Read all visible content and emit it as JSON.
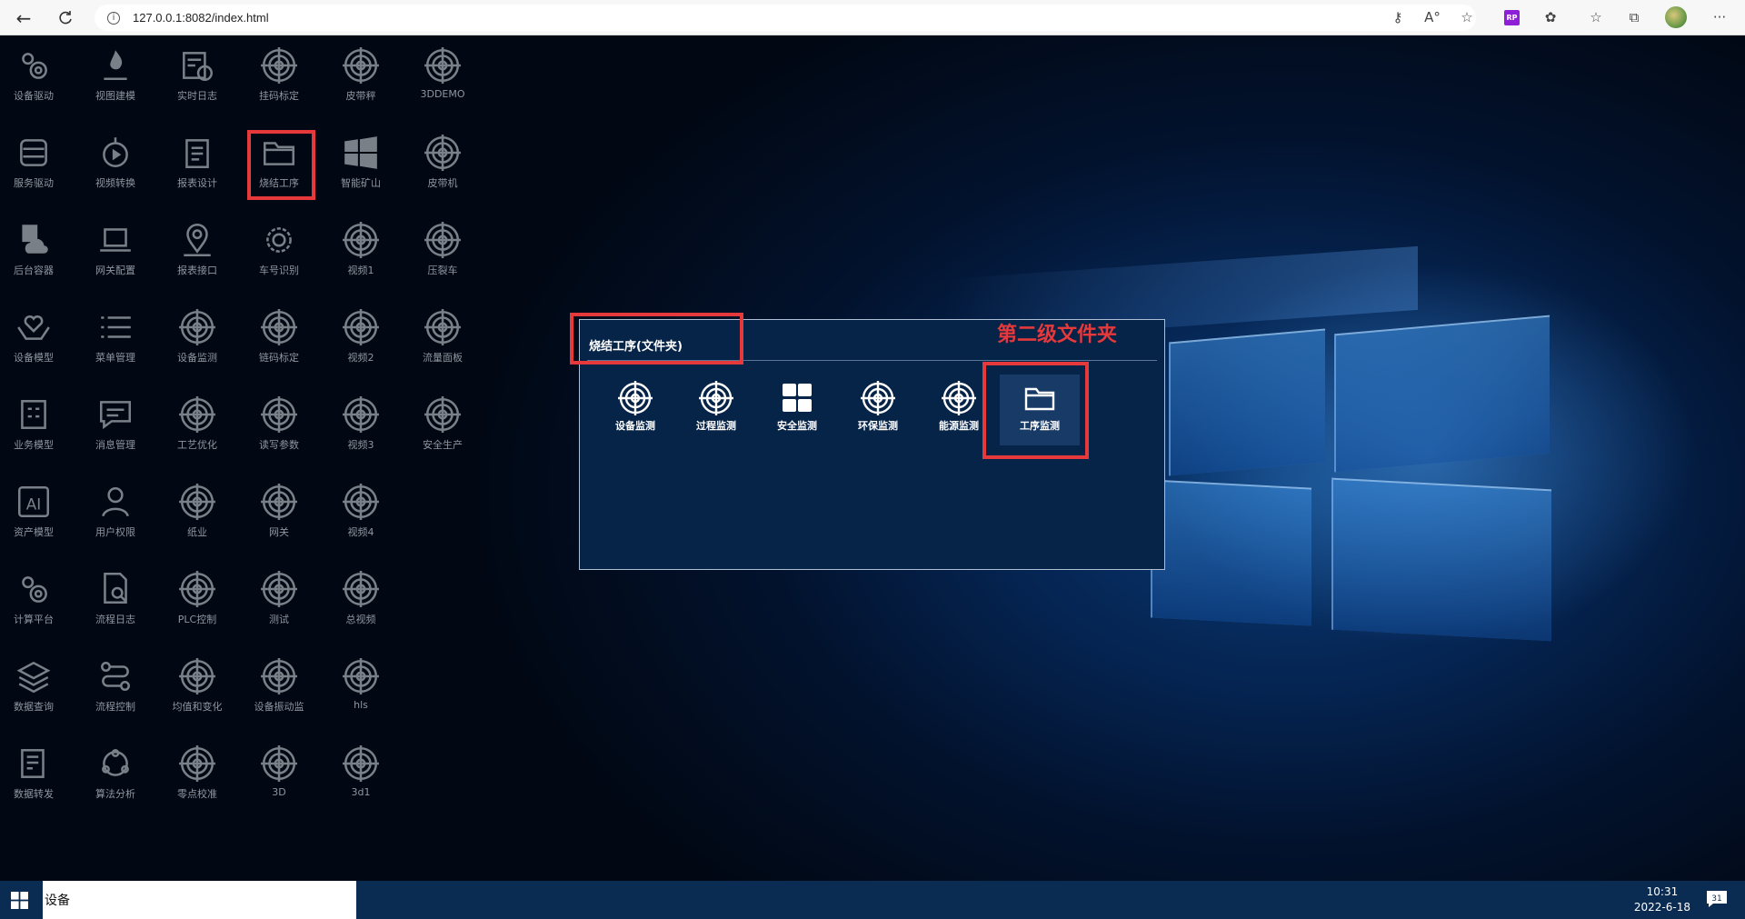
{
  "browser": {
    "url": "127.0.0.1:8082/index.html",
    "rp_badge": "RP"
  },
  "desktop_icons": [
    {
      "label": "设备驱动",
      "icon": "gears-icon"
    },
    {
      "label": "视图建模",
      "icon": "flame-icon"
    },
    {
      "label": "实时日志",
      "icon": "calendar-clock-icon"
    },
    {
      "label": "挂码标定",
      "icon": "target-icon"
    },
    {
      "label": "皮带秤",
      "icon": "target-icon"
    },
    {
      "label": "3DDEMO",
      "icon": "target-icon"
    },
    {
      "label": "服务驱动",
      "icon": "server-icon"
    },
    {
      "label": "视频转换",
      "icon": "play-circle-icon"
    },
    {
      "label": "报表设计",
      "icon": "clipboard-icon"
    },
    {
      "label": "烧结工序",
      "icon": "folder-icon"
    },
    {
      "label": "智能矿山",
      "icon": "windows-icon"
    },
    {
      "label": "皮带机",
      "icon": "target-icon"
    },
    {
      "label": "后台容器",
      "icon": "doc-cloud-icon"
    },
    {
      "label": "网关配置",
      "icon": "laptop-icon"
    },
    {
      "label": "报表接口",
      "icon": "location-pin-icon"
    },
    {
      "label": "车号识别",
      "icon": "gear-icon"
    },
    {
      "label": "视频1",
      "icon": "target-icon"
    },
    {
      "label": "压裂车",
      "icon": "target-icon"
    },
    {
      "label": "设备模型",
      "icon": "hands-icon"
    },
    {
      "label": "菜单管理",
      "icon": "list-icon"
    },
    {
      "label": "设备监测",
      "icon": "target-icon"
    },
    {
      "label": "链码标定",
      "icon": "target-icon"
    },
    {
      "label": "视频2",
      "icon": "target-icon"
    },
    {
      "label": "流量面板",
      "icon": "target-icon"
    },
    {
      "label": "业务模型",
      "icon": "building-icon"
    },
    {
      "label": "消息管理",
      "icon": "message-icon"
    },
    {
      "label": "工艺优化",
      "icon": "target-icon"
    },
    {
      "label": "读写参数",
      "icon": "target-icon"
    },
    {
      "label": "视频3",
      "icon": "target-icon"
    },
    {
      "label": "安全生产",
      "icon": "target-icon"
    },
    {
      "label": "资产模型",
      "icon": "ai-icon"
    },
    {
      "label": "用户权限",
      "icon": "user-icon"
    },
    {
      "label": "纸业",
      "icon": "target-icon"
    },
    {
      "label": "网关",
      "icon": "target-icon"
    },
    {
      "label": "视频4",
      "icon": "target-icon"
    },
    {
      "label": "计算平台",
      "icon": "gears-icon"
    },
    {
      "label": "流程日志",
      "icon": "doc-search-icon"
    },
    {
      "label": "PLC控制",
      "icon": "target-icon"
    },
    {
      "label": "测试",
      "icon": "target-icon"
    },
    {
      "label": "总视频",
      "icon": "target-icon"
    },
    {
      "label": "数据查询",
      "icon": "layers-icon"
    },
    {
      "label": "流程控制",
      "icon": "flow-icon"
    },
    {
      "label": "均值和变化",
      "icon": "target-icon"
    },
    {
      "label": "设备振动监",
      "icon": "target-icon"
    },
    {
      "label": "hls",
      "icon": "target-icon"
    },
    {
      "label": "数据转发",
      "icon": "doc-edit-icon"
    },
    {
      "label": "算法分析",
      "icon": "network-icon"
    },
    {
      "label": "零点校准",
      "icon": "target-icon"
    },
    {
      "label": "3D",
      "icon": "target-icon"
    },
    {
      "label": "3d1",
      "icon": "target-icon"
    }
  ],
  "dialog": {
    "title": "烧结工序(文件夹)",
    "items": [
      {
        "label": "设备监测",
        "icon": "target-icon"
      },
      {
        "label": "过程监测",
        "icon": "target-icon"
      },
      {
        "label": "安全监测",
        "icon": "tiles-icon"
      },
      {
        "label": "环保监测",
        "icon": "target-icon"
      },
      {
        "label": "能源监测",
        "icon": "target-icon"
      },
      {
        "label": "工序监测",
        "icon": "folder-icon"
      }
    ]
  },
  "annotation": "第二级文件夹",
  "highlight_color": "#e5393c",
  "taskbar": {
    "search_text": "设备",
    "time": "10:31",
    "date": "2022-6-18",
    "notification_count": "31"
  }
}
